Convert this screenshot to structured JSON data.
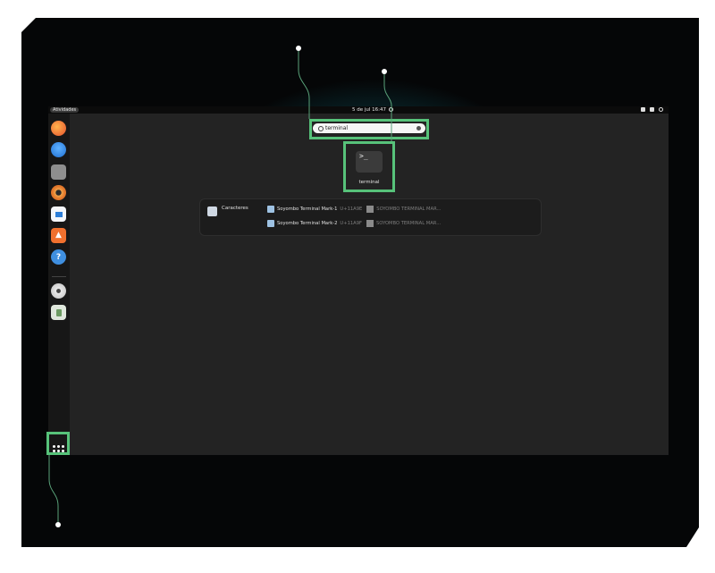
{
  "topbar": {
    "activities_label": "Atividades",
    "clock": "5 de jul  16:47",
    "tray_icons": [
      "network-icon",
      "volume-icon",
      "power-icon"
    ]
  },
  "dock": {
    "apps": [
      "firefox-icon",
      "thunderbird-icon",
      "files-icon",
      "rhythmbox-icon",
      "writer-icon",
      "app-center-icon",
      "help-icon",
      "dvd-icon",
      "trash-icon"
    ],
    "show_apps_icon": "app-grid-icon"
  },
  "search": {
    "query": "terminal"
  },
  "app_result": {
    "icon_text": ">_",
    "label": "terminal"
  },
  "provider": {
    "name": "Caracteres",
    "results": [
      {
        "title": "Soyombo Terminal Mark-1",
        "code": "U+11A9E",
        "description": "SOYOMBO TERMINAL MAR..."
      },
      {
        "title": "Soyombo Terminal Mark-2",
        "code": "U+11A9F",
        "description": "SOYOMBO TERMINAL MAR..."
      }
    ]
  },
  "colors": {
    "highlight": "#57c27a",
    "glow": "#26d6e4",
    "panel_bg": "#232323"
  }
}
